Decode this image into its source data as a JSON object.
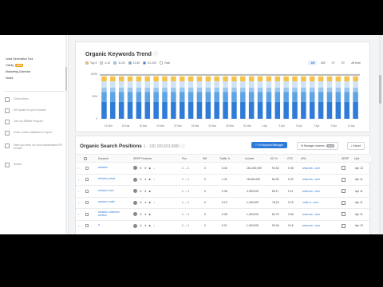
{
  "sidebar": {
    "links": [
      {
        "label": "Lead Generation Tool",
        "badge": ""
      },
      {
        "label": "Clarity",
        "badge": "NEW"
      },
      {
        "label": "Marketing Calendar",
        "badge": ""
      },
      {
        "label": "Notes",
        "badge": ""
      }
    ],
    "items": [
      {
        "label": "Online demo",
        "icon": "monitor-icon"
      },
      {
        "label": "SEOquake for your browser",
        "icon": "browser-icon"
      },
      {
        "label": "Join our Affiliate Program",
        "icon": "handshake-icon"
      },
      {
        "label": "Order custom database or report",
        "icon": "database-icon"
      },
      {
        "label": "Have you seen our new customizable API format?",
        "icon": "api-icon"
      },
      {
        "label": "Sensor",
        "icon": "sensor-icon"
      }
    ]
  },
  "trend": {
    "title": "Organic Keywords Trend",
    "legend": [
      {
        "label": "Top 3",
        "color": "#f5c24a"
      },
      {
        "label": "4-10",
        "color": "#cfe3f7"
      },
      {
        "label": "11-20",
        "color": "#9cc6ee"
      },
      {
        "label": "21-50",
        "color": "#5ea4e4"
      },
      {
        "label": "51-100",
        "color": "#2f7bd8"
      },
      {
        "label": "Total",
        "color": "#ffffff"
      }
    ],
    "ranges": [
      "1M",
      "6M",
      "1Y",
      "2Y",
      "All time"
    ],
    "active_range": "1M"
  },
  "chart_data": {
    "type": "bar",
    "title": "Organic Keywords Trend",
    "y_ticks": [
      "100M",
      "50M",
      "0"
    ],
    "ylim": [
      0,
      100000000
    ],
    "x_labels": [
      "14 Mar",
      "16 Mar",
      "18 Mar",
      "20 Mar",
      "22 Mar",
      "24 Mar",
      "26 Mar",
      "28 Mar",
      "30 Mar",
      "1 Apr",
      "3 Apr",
      "5 Apr",
      "7 Apr",
      "9 Apr",
      "11 Apr"
    ],
    "bar_count": 30,
    "series": [
      {
        "name": "51-100",
        "values": [
          38000000,
          38000000,
          38000000,
          38000000,
          38000000,
          38000000,
          38000000,
          38000000,
          38000000,
          38000000,
          38000000,
          38000000,
          38000000,
          38000000,
          38000000,
          38000000,
          38000000,
          38000000,
          38000000,
          38000000,
          38000000,
          38000000,
          38000000,
          38000000,
          38000000,
          38000000,
          38000000,
          38000000,
          38000000,
          38000000
        ]
      },
      {
        "name": "21-50",
        "values": [
          22000000,
          22000000,
          22000000,
          22000000,
          22000000,
          22000000,
          22000000,
          22000000,
          22000000,
          22000000,
          22000000,
          22000000,
          22000000,
          22000000,
          22000000,
          22000000,
          22000000,
          22000000,
          22000000,
          22000000,
          22000000,
          22000000,
          22000000,
          22000000,
          22000000,
          22000000,
          22000000,
          22000000,
          22000000,
          22000000
        ]
      },
      {
        "name": "11-20",
        "values": [
          10000000,
          10000000,
          10000000,
          10000000,
          10000000,
          10000000,
          10000000,
          10000000,
          10000000,
          10000000,
          10000000,
          10000000,
          10000000,
          10000000,
          10000000,
          10000000,
          10000000,
          10000000,
          10000000,
          10000000,
          10000000,
          10000000,
          10000000,
          10000000,
          10000000,
          10000000,
          10000000,
          10000000,
          10000000,
          10000000
        ]
      },
      {
        "name": "4-10",
        "values": [
          14000000,
          14000000,
          14000000,
          14000000,
          14000000,
          14000000,
          14000000,
          14000000,
          14000000,
          14000000,
          14000000,
          14000000,
          14000000,
          14000000,
          14000000,
          14000000,
          14000000,
          14000000,
          14000000,
          14000000,
          14000000,
          14000000,
          14000000,
          14000000,
          14000000,
          14000000,
          14000000,
          14000000,
          14000000,
          14000000
        ]
      },
      {
        "name": "Top 3",
        "values": [
          11000000,
          11000000,
          11000000,
          11000000,
          11000000,
          11000000,
          11000000,
          11000000,
          11000000,
          11000000,
          11000000,
          11000000,
          11000000,
          11000000,
          11000000,
          11000000,
          11000000,
          11000000,
          11000000,
          11000000,
          11000000,
          11000000,
          11000000,
          11000000,
          11000000,
          11000000,
          11000000,
          11000000,
          11000000,
          11000000
        ]
      }
    ]
  },
  "positions": {
    "title": "Organic Search Positions",
    "subtitle": "1 - 100 (90,653,808)",
    "buttons": {
      "to_manager": "To Keyword Manager",
      "manage_columns": "Manage columns",
      "columns_count": "14/20",
      "export": "Export"
    },
    "columns": [
      "Keyword",
      "SERP Features",
      "Pos.",
      "Diff",
      "Traffic %",
      "Volume",
      "KD %",
      "CPC",
      "URL",
      "SERP",
      "Upd."
    ],
    "rows": [
      {
        "keyword": "amazon",
        "features": "⊕ ★ ▶ ♪",
        "pos": "1 → 1",
        "diff": "0",
        "traffic": "8.34",
        "volume": "151,000,000",
        "kd": "92.52",
        "cpc": "0.06",
        "url": "www.am...com",
        "upd": "Apr 12"
      },
      {
        "keyword": "amazon prime",
        "features": "⊕ ★ ▶ ♪",
        "pos": "1 → 1",
        "diff": "0",
        "traffic": "1.41",
        "volume": "16,600,000",
        "kd": "84.90",
        "cpc": "0.02",
        "url": "www.am...com",
        "upd": "Apr 11"
      },
      {
        "keyword": "amazon.com",
        "features": "⊕ ★ ▶",
        "pos": "1 → 1",
        "diff": "0",
        "traffic": "0.38",
        "volume": "4,090,000",
        "kd": "89.17",
        "cpc": "0.11",
        "url": "www.am...com",
        "upd": "Apr 11"
      },
      {
        "keyword": "amazon smile",
        "features": "⊕ ★ ▶ ♪",
        "pos": "1 → 1",
        "diff": "0",
        "traffic": "0.19",
        "volume": "2,240,000",
        "kd": "78.23",
        "cpc": "0.15",
        "url": "smile.a...com",
        "upd": "Apr 11"
      },
      {
        "keyword": "amazon customer service",
        "features": "⊕ ★ ▶",
        "pos": "1 → 1",
        "diff": "0",
        "traffic": "0.08",
        "volume": "1,000,000",
        "kd": "80.76",
        "cpc": "0.06",
        "url": "www.am...com",
        "upd": "Apr 11"
      },
      {
        "keyword": "a",
        "features": "⊕ ★ ▶ ♪",
        "pos": "1 → 1",
        "diff": "0",
        "traffic": "0.07",
        "volume": "1,000,000",
        "kd": "90.34",
        "cpc": "0.16",
        "url": "www.am...com",
        "upd": "Apr 12"
      }
    ]
  },
  "colors": {
    "accent": "#2f7bd8",
    "badge": "#f5a623"
  }
}
